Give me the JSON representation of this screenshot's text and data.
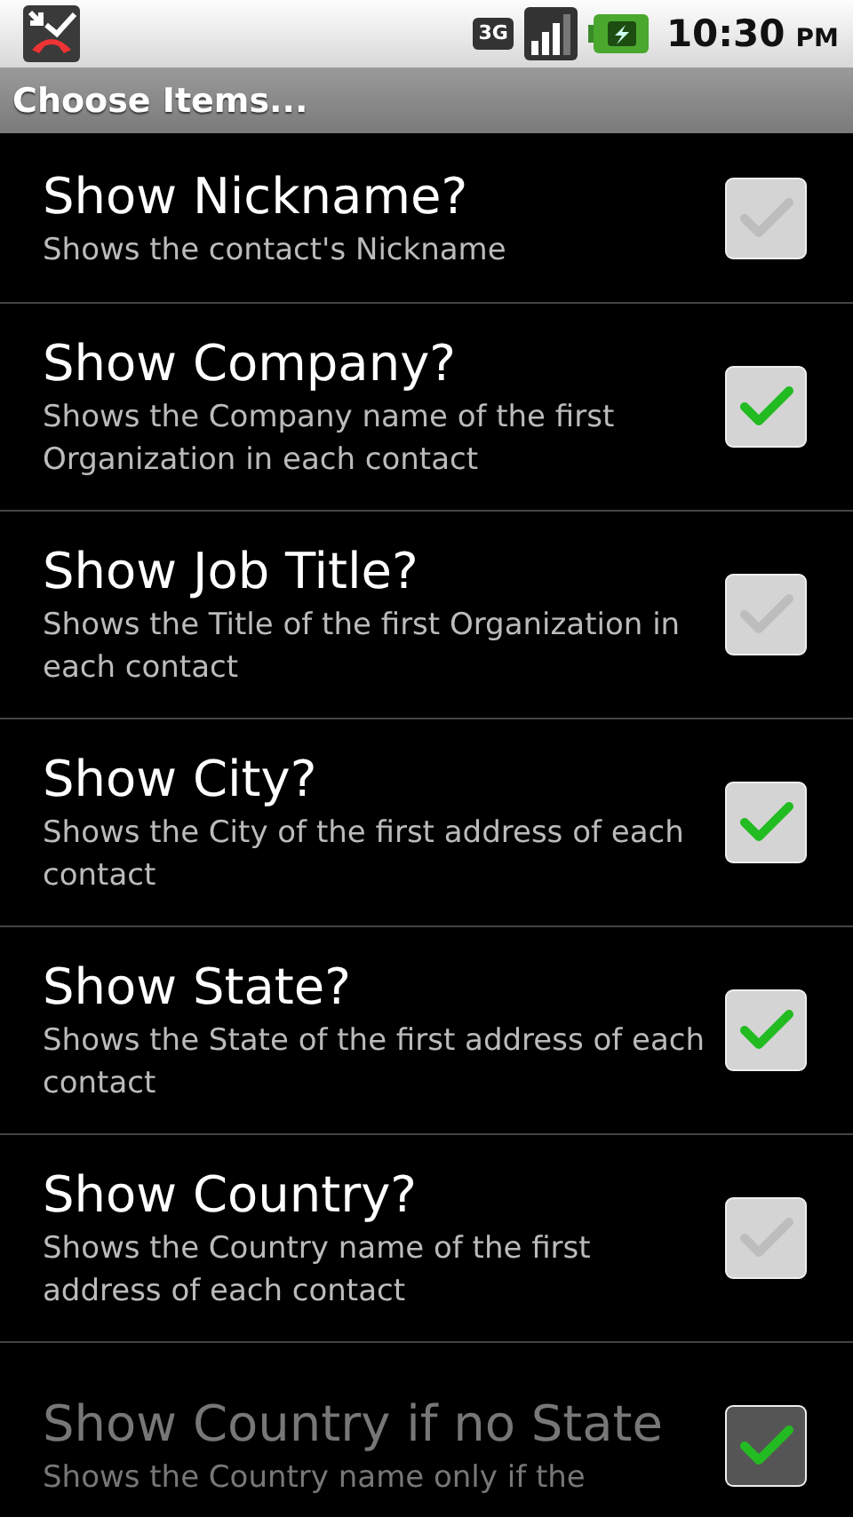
{
  "status_bar": {
    "network": "3G",
    "time": "10:30",
    "ampm": "PM"
  },
  "title_bar": {
    "title": "Choose Items..."
  },
  "items": [
    {
      "title": "Show Nickname?",
      "summary": "Shows the contact's Nickname",
      "checked": false,
      "disabled": false
    },
    {
      "title": "Show Company?",
      "summary": "Shows the Company name of the first Organization in each contact",
      "checked": true,
      "disabled": false
    },
    {
      "title": "Show Job Title?",
      "summary": "Shows the Title of the first Organization in each contact",
      "checked": false,
      "disabled": false
    },
    {
      "title": "Show City?",
      "summary": "Shows the City of the first address of each contact",
      "checked": true,
      "disabled": false
    },
    {
      "title": "Show State?",
      "summary": "Shows the State of the first address of each contact",
      "checked": true,
      "disabled": false
    },
    {
      "title": "Show Country?",
      "summary": "Shows the Country name of the first address of each contact",
      "checked": false,
      "disabled": false
    },
    {
      "title": "Show Country if no State",
      "summary": "Shows the Country name only if the",
      "checked": true,
      "disabled": true
    }
  ]
}
